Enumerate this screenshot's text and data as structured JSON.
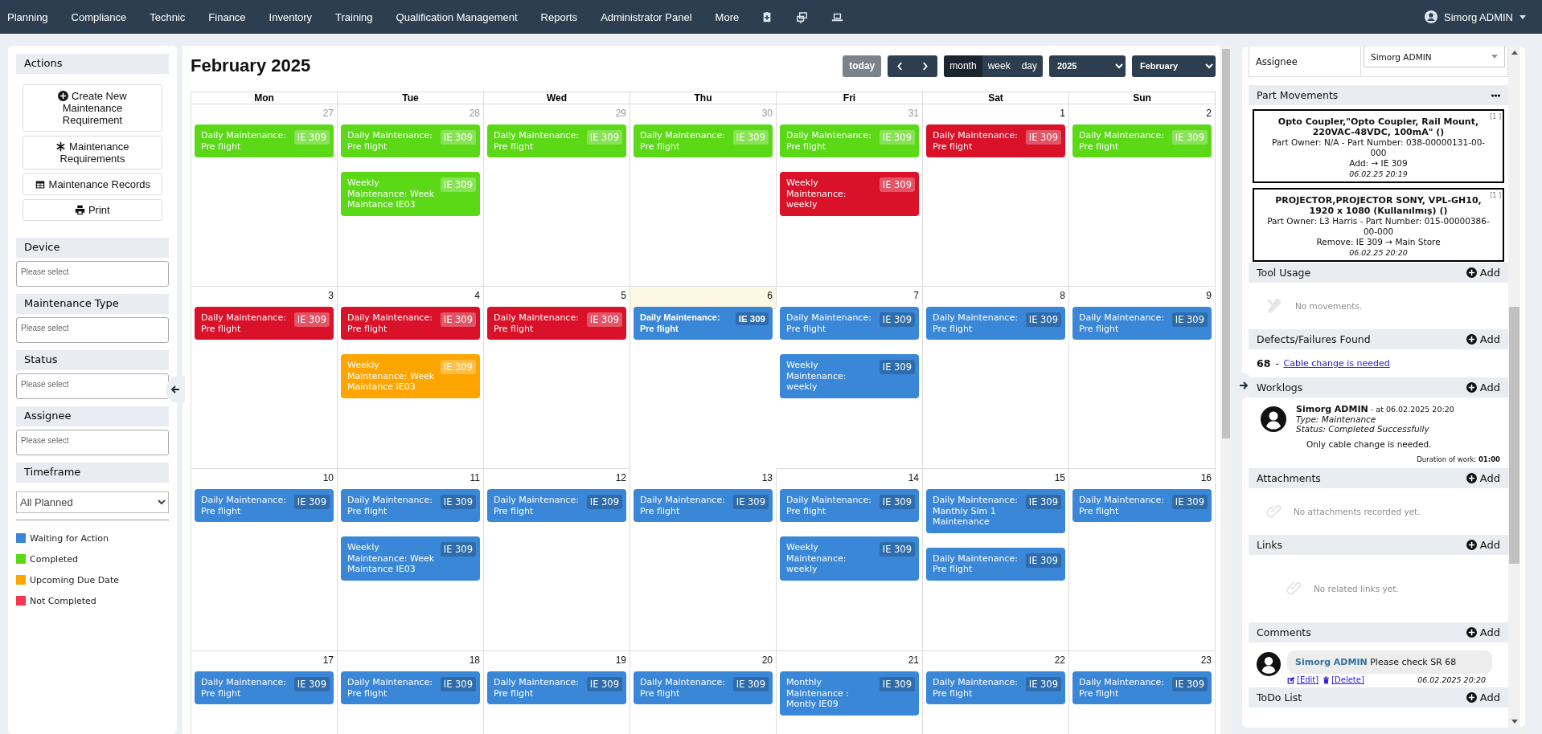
{
  "nav": {
    "items": [
      "Planning",
      "Compliance",
      "Technic",
      "Finance",
      "Inventory",
      "Training",
      "Qualification Management",
      "Reports",
      "Administrator Panel",
      "More"
    ],
    "user": "Simorg ADMIN"
  },
  "sidebar": {
    "actions_title": "Actions",
    "actions": [
      "Create New Maintenance Requirement",
      "Maintenance Requirements",
      "Maintenance Records",
      "Print"
    ],
    "filters": [
      {
        "label": "Device",
        "placeholder": "Please select"
      },
      {
        "label": "Maintenance Type",
        "placeholder": "Please select"
      },
      {
        "label": "Status",
        "placeholder": "Please select"
      },
      {
        "label": "Assignee",
        "placeholder": "Please select"
      }
    ],
    "timeframe": {
      "label": "Timeframe",
      "value": "All Planned"
    },
    "legend": [
      {
        "label": "Waiting for Action",
        "color": "#3a87d8"
      },
      {
        "label": "Completed",
        "color": "#5cd916"
      },
      {
        "label": "Upcoming Due Date",
        "color": "#ffa500"
      },
      {
        "label": "Not Completed",
        "color": "#f5364e"
      }
    ]
  },
  "calendar": {
    "title": "February 2025",
    "today_button": "today",
    "views": [
      {
        "label": "month",
        "selected": true
      },
      {
        "label": "week",
        "selected": false
      },
      {
        "label": "day",
        "selected": false
      }
    ],
    "year": "2025",
    "month": "February",
    "weekdays": [
      "Mon",
      "Tue",
      "Wed",
      "Thu",
      "Fri",
      "Sat",
      "Sun"
    ],
    "weeks": [
      [
        {
          "day": "27",
          "other_month": true,
          "today": false,
          "events": [
            {
              "title": "Daily Maintenance: Pre flight",
              "badge": "IE 309",
              "color": "#5cd916"
            }
          ]
        },
        {
          "day": "28",
          "other_month": true,
          "today": false,
          "events": [
            {
              "title": "Daily Maintenance: Pre flight",
              "badge": "IE 309",
              "color": "#5cd916"
            },
            {
              "title": "Weekly Maintenance: Week Maintance IE03",
              "badge": "IE 309",
              "color": "#5cd916"
            }
          ]
        },
        {
          "day": "29",
          "other_month": true,
          "today": false,
          "events": [
            {
              "title": "Daily Maintenance: Pre flight",
              "badge": "IE 309",
              "color": "#5cd916"
            }
          ]
        },
        {
          "day": "30",
          "other_month": true,
          "today": false,
          "events": [
            {
              "title": "Daily Maintenance: Pre flight",
              "badge": "IE 309",
              "color": "#5cd916"
            }
          ]
        },
        {
          "day": "31",
          "other_month": true,
          "today": false,
          "events": [
            {
              "title": "Daily Maintenance: Pre flight",
              "badge": "IE 309",
              "color": "#5cd916"
            },
            {
              "title": "Weekly Maintenance: weekly",
              "badge": "IE 309",
              "color": "#d9122a"
            }
          ]
        },
        {
          "day": "1",
          "other_month": false,
          "today": false,
          "events": [
            {
              "title": "Daily Maintenance: Pre flight",
              "badge": "IE 309",
              "color": "#d9122a"
            }
          ]
        },
        {
          "day": "2",
          "other_month": false,
          "today": false,
          "events": [
            {
              "title": "Daily Maintenance: Pre flight",
              "badge": "IE 309",
              "color": "#5cd916"
            }
          ]
        }
      ],
      [
        {
          "day": "3",
          "other_month": false,
          "today": false,
          "events": [
            {
              "title": "Daily Maintenance: Pre flight",
              "badge": "IE 309",
              "color": "#d9122a"
            }
          ]
        },
        {
          "day": "4",
          "other_month": false,
          "today": false,
          "events": [
            {
              "title": "Daily Maintenance: Pre flight",
              "badge": "IE 309",
              "color": "#d9122a"
            },
            {
              "title": "Weekly Maintenance: Week Maintance IE03",
              "badge": "IE 309",
              "color": "#ffa500"
            }
          ]
        },
        {
          "day": "5",
          "other_month": false,
          "today": false,
          "events": [
            {
              "title": "Daily Maintenance: Pre flight",
              "badge": "IE 309",
              "color": "#d9122a"
            }
          ]
        },
        {
          "day": "6",
          "other_month": false,
          "today": true,
          "events": [
            {
              "title": "Daily Maintenance: Pre flight",
              "badge": "IE 309",
              "color": "#3a87d8"
            }
          ]
        },
        {
          "day": "7",
          "other_month": false,
          "today": false,
          "events": [
            {
              "title": "Daily Maintenance: Pre flight",
              "badge": "IE 309",
              "color": "#3a87d8"
            },
            {
              "title": "Weekly Maintenance: weekly",
              "badge": "IE 309",
              "color": "#3a87d8"
            }
          ]
        },
        {
          "day": "8",
          "other_month": false,
          "today": false,
          "events": [
            {
              "title": "Daily Maintenance: Pre flight",
              "badge": "IE 309",
              "color": "#3a87d8"
            }
          ]
        },
        {
          "day": "9",
          "other_month": false,
          "today": false,
          "events": [
            {
              "title": "Daily Maintenance: Pre flight",
              "badge": "IE 309",
              "color": "#3a87d8"
            }
          ]
        }
      ],
      [
        {
          "day": "10",
          "other_month": false,
          "today": false,
          "events": [
            {
              "title": "Daily Maintenance: Pre flight",
              "badge": "IE 309",
              "color": "#3a87d8"
            }
          ]
        },
        {
          "day": "11",
          "other_month": false,
          "today": false,
          "events": [
            {
              "title": "Daily Maintenance: Pre flight",
              "badge": "IE 309",
              "color": "#3a87d8"
            },
            {
              "title": "Weekly Maintenance: Week Maintance IE03",
              "badge": "IE 309",
              "color": "#3a87d8"
            }
          ]
        },
        {
          "day": "12",
          "other_month": false,
          "today": false,
          "events": [
            {
              "title": "Daily Maintenance: Pre flight",
              "badge": "IE 309",
              "color": "#3a87d8"
            }
          ]
        },
        {
          "day": "13",
          "other_month": false,
          "today": false,
          "events": [
            {
              "title": "Daily Maintenance: Pre flight",
              "badge": "IE 309",
              "color": "#3a87d8"
            }
          ]
        },
        {
          "day": "14",
          "other_month": false,
          "today": false,
          "events": [
            {
              "title": "Daily Maintenance: Pre flight",
              "badge": "IE 309",
              "color": "#3a87d8"
            },
            {
              "title": "Weekly Maintenance: weekly",
              "badge": "IE 309",
              "color": "#3a87d8"
            }
          ]
        },
        {
          "day": "15",
          "other_month": false,
          "today": false,
          "events": [
            {
              "title": "Daily Maintenance: Manthly Sim 1 Maintenance",
              "badge": "IE 309",
              "color": "#3a87d8"
            },
            {
              "title": "Daily Maintenance: Pre flight",
              "badge": "IE 309",
              "color": "#3a87d8"
            }
          ]
        },
        {
          "day": "16",
          "other_month": false,
          "today": false,
          "events": [
            {
              "title": "Daily Maintenance: Pre flight",
              "badge": "IE 309",
              "color": "#3a87d8"
            }
          ]
        }
      ],
      [
        {
          "day": "17",
          "other_month": false,
          "today": false,
          "events": [
            {
              "title": "Daily Maintenance: Pre flight",
              "badge": "IE 309",
              "color": "#3a87d8"
            }
          ]
        },
        {
          "day": "18",
          "other_month": false,
          "today": false,
          "events": [
            {
              "title": "Daily Maintenance: Pre flight",
              "badge": "IE 309",
              "color": "#3a87d8"
            }
          ]
        },
        {
          "day": "19",
          "other_month": false,
          "today": false,
          "events": [
            {
              "title": "Daily Maintenance: Pre flight",
              "badge": "IE 309",
              "color": "#3a87d8"
            }
          ]
        },
        {
          "day": "20",
          "other_month": false,
          "today": false,
          "events": [
            {
              "title": "Daily Maintenance: Pre flight",
              "badge": "IE 309",
              "color": "#3a87d8"
            }
          ]
        },
        {
          "day": "21",
          "other_month": false,
          "today": false,
          "events": [
            {
              "title": "Monthly Maintenance : Montly IE09",
              "badge": "IE 309",
              "color": "#3a87d8"
            }
          ]
        },
        {
          "day": "22",
          "other_month": false,
          "today": false,
          "events": [
            {
              "title": "Daily Maintenance: Pre flight",
              "badge": "IE 309",
              "color": "#3a87d8"
            }
          ]
        },
        {
          "day": "23",
          "other_month": false,
          "today": false,
          "events": [
            {
              "title": "Daily Maintenance: Pre flight",
              "badge": "IE 309",
              "color": "#3a87d8"
            }
          ]
        }
      ]
    ]
  },
  "details": {
    "assignee": {
      "label": "Assignee",
      "value": "Simorg ADMIN"
    },
    "sections": [
      {
        "kind": "parts",
        "title": "Part Movements",
        "items": [
          {
            "count": "[1 ]",
            "name": "Opto Coupler,\"Opto Coupler, Rail Mount, 220VAC-48VDC, 100mA\" ()",
            "owner": "Part Owner: N/A - Part Number: 038-00000131-00-000",
            "action": "Add: → IE 309",
            "time": "06.02.25 20:19"
          },
          {
            "count": "[1 ]",
            "name": "PROJECTOR,PROJECTOR SONY, VPL-GH10, 1920 x 1080 (Kullanılmış) ()",
            "owner": "Part Owner: L3 Harris - Part Number: 015-00000386-00-000",
            "action": "Remove: IE 309 → Main Store",
            "time": "06.02.25 20:20"
          }
        ]
      },
      {
        "kind": "tools",
        "title": "Tool Usage",
        "add": "Add",
        "empty": "No movements."
      },
      {
        "kind": "defects",
        "title": "Defects/Failures Found",
        "add": "Add",
        "items": [
          {
            "number": "68",
            "separator": "-",
            "link": "Cable change is needed"
          }
        ]
      },
      {
        "kind": "worklogs",
        "title": "Worklogs",
        "add": "Add",
        "items": [
          {
            "author": "Simorg ADMIN",
            "at": "- at 06.02.2025 20:20",
            "type": "Type: Maintenance",
            "status": "Status: Completed Successfully",
            "text": "Only cable change is needed.",
            "duration_label": "Duration of work:",
            "duration": "01:00"
          }
        ]
      },
      {
        "kind": "attachments",
        "title": "Attachments",
        "add": "Add",
        "empty": "No attachments recorded yet."
      },
      {
        "kind": "links",
        "title": "Links",
        "add": "Add",
        "empty": "No related links yet."
      },
      {
        "kind": "comments",
        "title": "Comments",
        "add": "Add",
        "items": [
          {
            "author": "Simorg ADMIN",
            "text": "Please check SR 68",
            "edit": "[Edit]",
            "delete": "[Delete]",
            "time": "06.02.2025 20:20"
          }
        ]
      },
      {
        "kind": "todo",
        "title": "ToDo List",
        "add": "Add"
      }
    ]
  }
}
